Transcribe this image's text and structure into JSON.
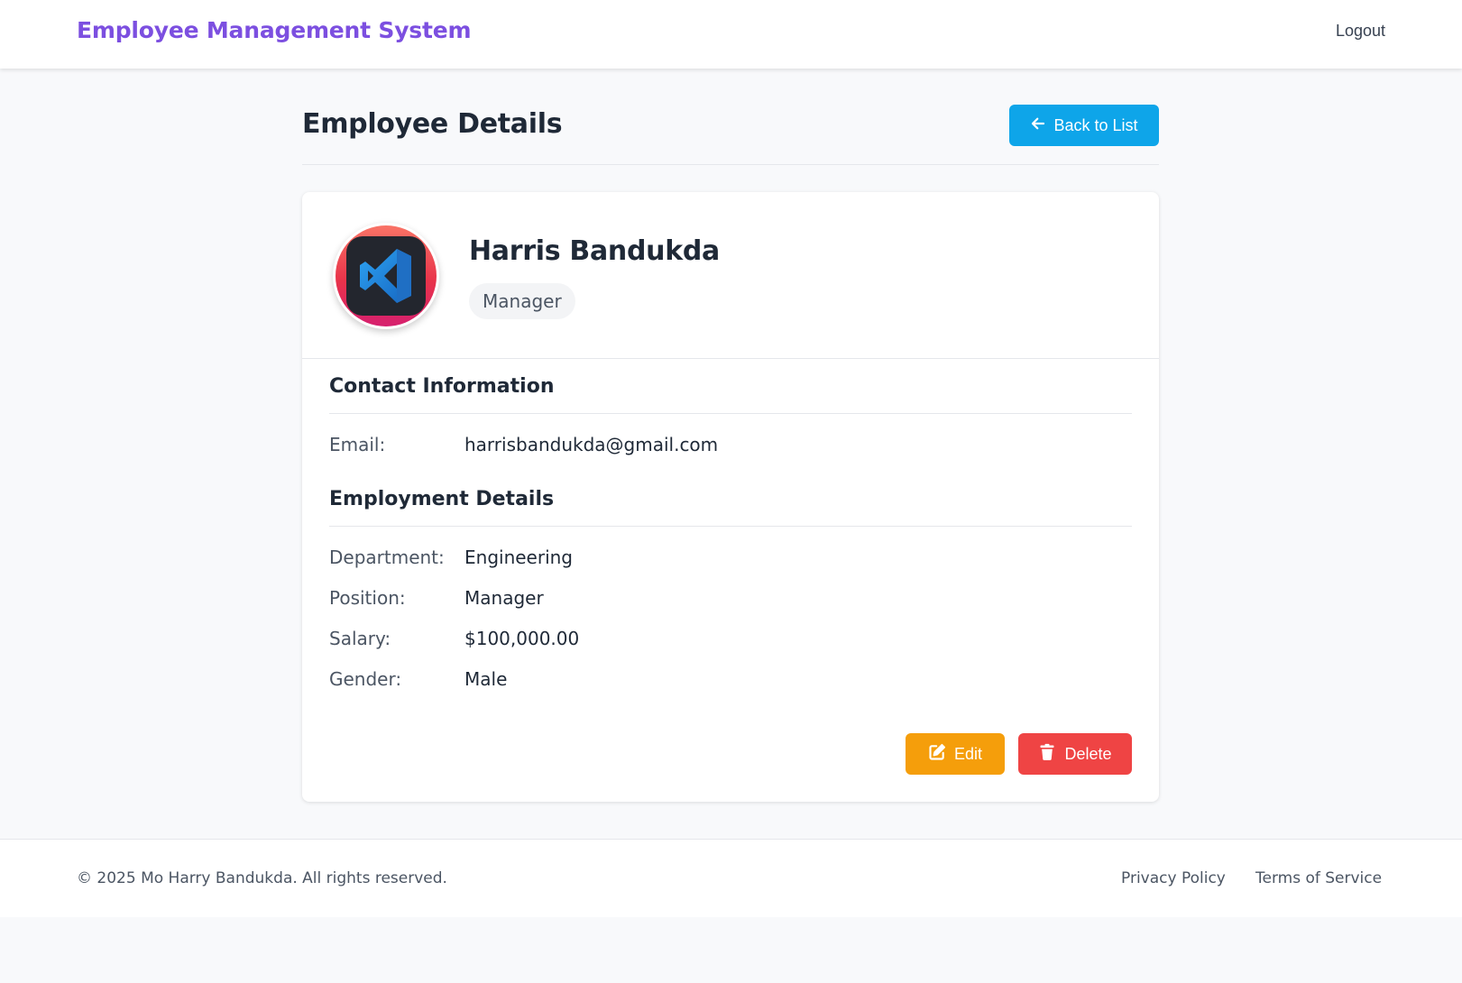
{
  "header": {
    "brand": "Employee Management System",
    "logout_label": "Logout"
  },
  "page": {
    "title": "Employee Details",
    "back_label": "Back to List"
  },
  "employee": {
    "name": "Harris Bandukda",
    "role_badge": "Manager",
    "avatar_icon": "vscode-logo-icon"
  },
  "contact": {
    "title": "Contact Information",
    "fields": [
      {
        "label": "Email:",
        "value": "harrisbandukda@gmail.com"
      }
    ]
  },
  "employment": {
    "title": "Employment Details",
    "fields": [
      {
        "label": "Department:",
        "value": "Engineering"
      },
      {
        "label": "Position:",
        "value": "Manager"
      },
      {
        "label": "Salary:",
        "value": "$100,000.00"
      },
      {
        "label": "Gender:",
        "value": "Male"
      }
    ]
  },
  "actions": {
    "edit_label": "Edit",
    "delete_label": "Delete"
  },
  "footer": {
    "copyright": "© 2025 Mo Harry Bandukda. All rights reserved.",
    "privacy_label": "Privacy Policy",
    "terms_label": "Terms of Service"
  },
  "colors": {
    "brand": "#7c4fe0",
    "back_button": "#0ea5e9",
    "edit_button": "#f59e0b",
    "delete_button": "#ef4444"
  }
}
